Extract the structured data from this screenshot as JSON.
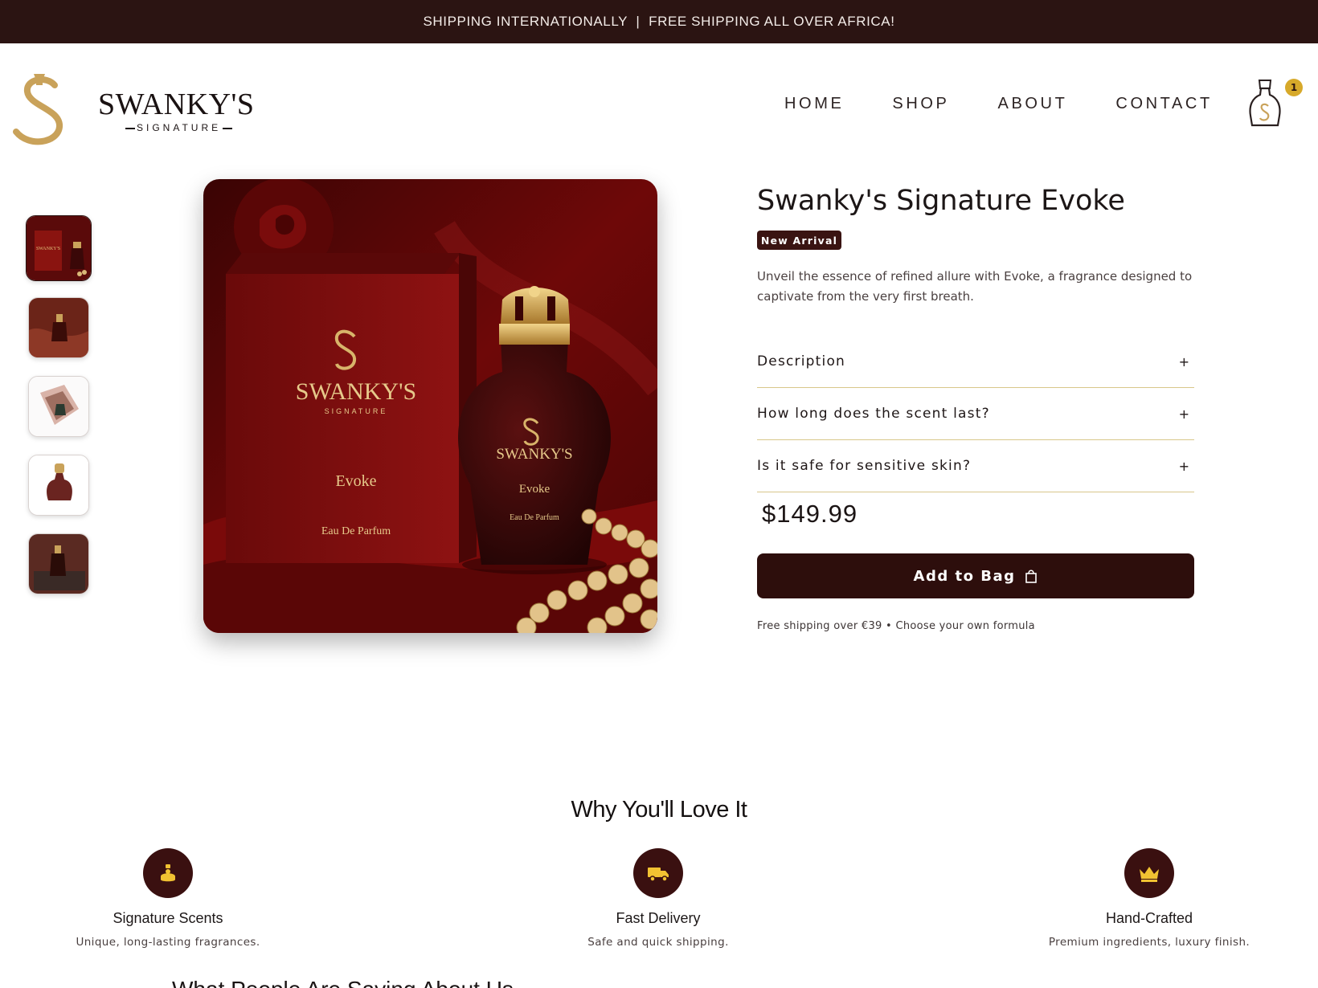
{
  "announcement": "SHIPPING INTERNATIONALLY  |  FREE SHIPPING ALL OVER AFRICA!",
  "brand": {
    "name": "SWANKY'S",
    "tagline": "SIGNATURE",
    "box_name": "Evoke",
    "box_type": "Eau De Parfum"
  },
  "nav": {
    "items": [
      "HOME",
      "SHOP",
      "ABOUT",
      "CONTACT"
    ]
  },
  "cart": {
    "count": "1"
  },
  "colors": {
    "dark_brown": "#2b1412",
    "gold": "#d7a92a",
    "accent_line": "#d8c78a",
    "cta": "#2d0e0c"
  },
  "gallery": {
    "thumbnail_count": 5,
    "active_index": 0
  },
  "product": {
    "title": "Swanky's Signature Evoke",
    "badge": "New Arrival",
    "blurb": "Unveil the essence of refined allure with Evoke, a fragrance designed to captivate from the very first breath.",
    "price": "$149.99",
    "cta_label": "Add to Bag",
    "shipping_note": "Free shipping over €39 • Choose your own formula"
  },
  "accordion": [
    {
      "question": "Description",
      "icon": "+"
    },
    {
      "question": "How long does the scent last?",
      "icon": "+"
    },
    {
      "question": "Is it safe for sensitive skin?",
      "icon": "+"
    }
  ],
  "why": {
    "title": "Why You'll Love It",
    "features": [
      {
        "title": "Signature Scents",
        "desc": "Unique, long-lasting fragrances.",
        "icon": "perfume-icon"
      },
      {
        "title": "Fast Delivery",
        "desc": "Safe and quick shipping.",
        "icon": "truck-icon"
      },
      {
        "title": "Hand-Crafted",
        "desc": "Premium ingredients, luxury finish.",
        "icon": "crown-icon"
      }
    ]
  },
  "next_section_title": "What People Are Saying About Us"
}
